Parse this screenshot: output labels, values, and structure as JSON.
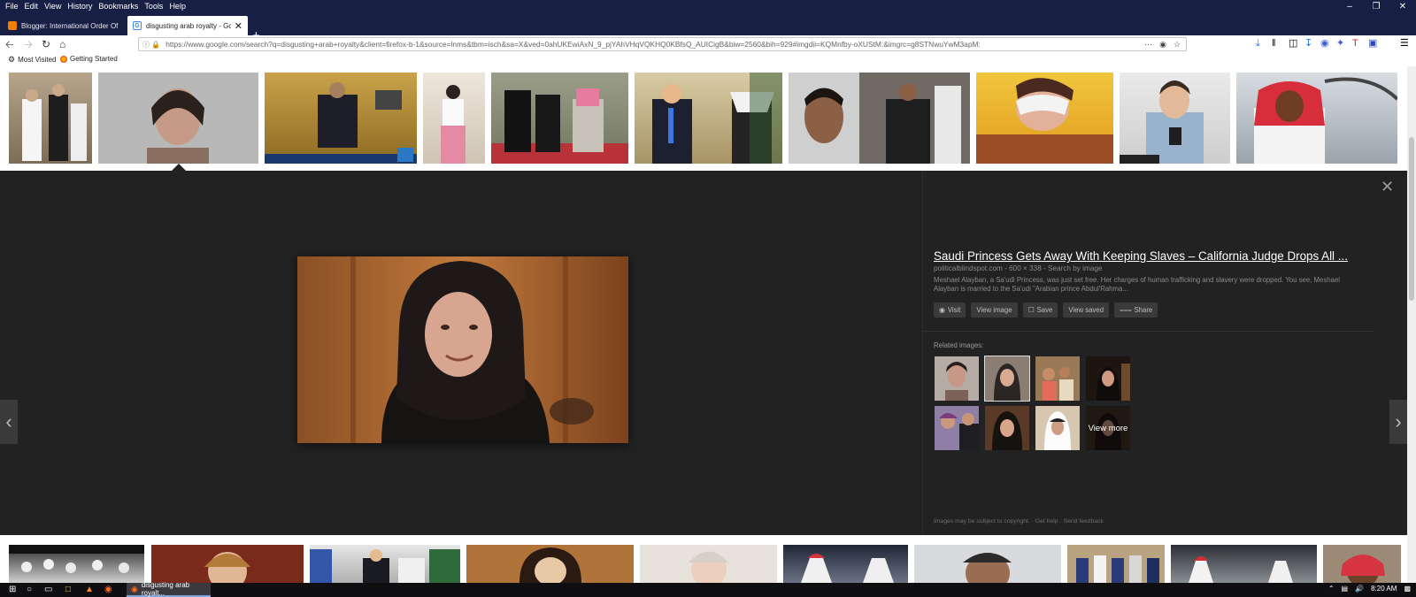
{
  "menu": {
    "items": [
      "File",
      "Edit",
      "View",
      "History",
      "Bookmarks",
      "Tools",
      "Help"
    ]
  },
  "tabs": [
    {
      "label": "Blogger: International Order Of",
      "active": false,
      "favicon_color": "#f57d00"
    },
    {
      "label": "disgusting arab royalty - Googl",
      "active": true,
      "favicon_color": "#4285f4"
    }
  ],
  "nav": {
    "url": "https://www.google.com/search?q=disgusting+arab+royalty&client=firefox-b-1&source=lnms&tbm=isch&sa=X&ved=0ahUKEwiAxN_9_pjYAhVHqVQKHQ0KBfsQ_AUICigB&biw=2560&bih=929#imgdii=KQMnfby-oXUStM:&imgrc=g8STNwuYwM3apM:"
  },
  "bookmarks": [
    {
      "label": "Most Visited",
      "icon": "gear-icon"
    },
    {
      "label": "Getting Started",
      "icon": "firefox-icon"
    }
  ],
  "preview": {
    "title": "Saudi Princess Gets Away With Keeping Slaves – California Judge Drops All ...",
    "source": "politicalblindspot.com - 600 × 338 - Search by image",
    "description": "Meshael Alayban, a Sa'udi Princess, was just set free. Her charges of human trafficking and slavery were dropped. You see, Meshael Alayban is married to the Sa'udi \"Arabian prince Abdul'Rahma...",
    "buttons": [
      {
        "label": "Visit",
        "icon": "globe-icon"
      },
      {
        "label": "View image",
        "icon": ""
      },
      {
        "label": "Save",
        "icon": "bookmark-icon"
      },
      {
        "label": "View saved",
        "icon": ""
      },
      {
        "label": "Share",
        "icon": "share-icon"
      }
    ],
    "related_label": "Related images:",
    "view_more": "View more",
    "footer": "Images may be subject to copyright. · Get help · Send feedback"
  },
  "taskbar": {
    "active_task": "disgusting arab royalt...",
    "time": "8:20 AM"
  }
}
